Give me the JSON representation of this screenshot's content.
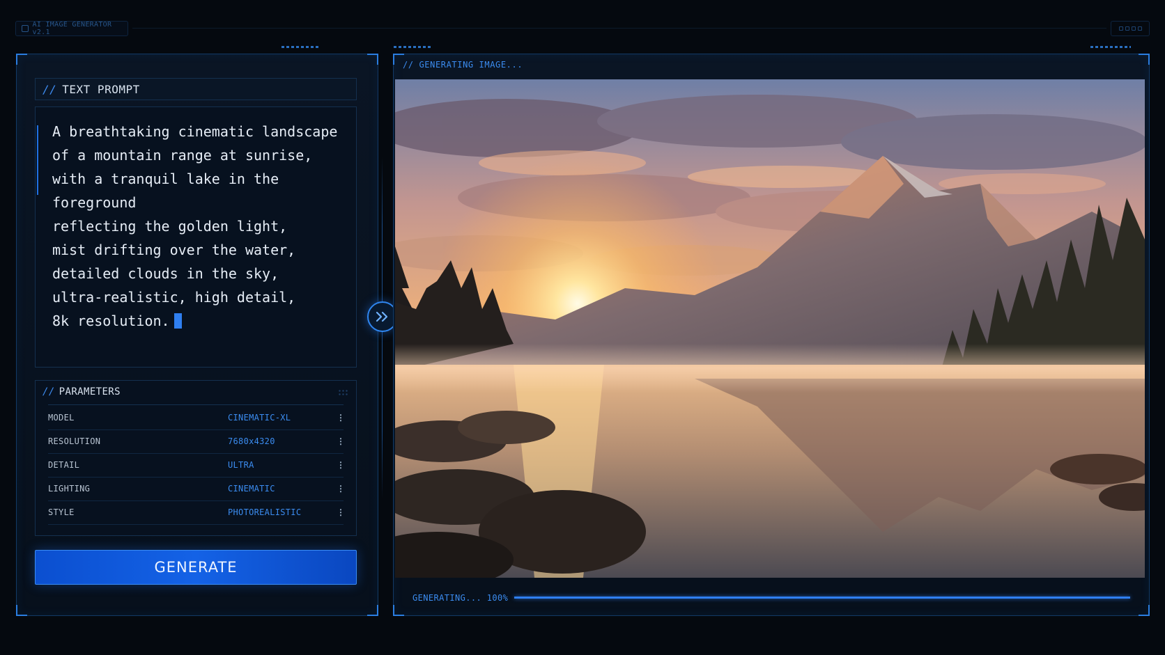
{
  "header": {
    "app_title": "AI IMAGE GENERATOR v2.1"
  },
  "prompt_section": {
    "title": "TEXT PROMPT",
    "prompt_text": "A breathtaking cinematic landscape\nof a mountain range at sunrise,\nwith a tranquil lake in the foreground\nreflecting the golden light,\nmist drifting over the water,\ndetailed clouds in the sky,\nultra-realistic, high detail,\n8k resolution."
  },
  "parameters": {
    "title": "PARAMETERS",
    "rows": [
      {
        "key": "MODEL",
        "value": "CINEMATIC-XL"
      },
      {
        "key": "RESOLUTION",
        "value": "7680x4320"
      },
      {
        "key": "DETAIL",
        "value": "ULTRA"
      },
      {
        "key": "LIGHTING",
        "value": "CINEMATIC"
      },
      {
        "key": "STYLE",
        "value": "PHOTOREALISTIC"
      }
    ]
  },
  "generate_button": {
    "label": "GENERATE"
  },
  "output": {
    "header_label": "// GENERATING IMAGE...",
    "status_text": "GENERATING... 100%",
    "progress": 1.0,
    "image_name": "sunrise-mountain-lake-image"
  },
  "colors": {
    "accent": "#2f7ff0",
    "background": "#05090f",
    "panel_border": "#123a66"
  }
}
